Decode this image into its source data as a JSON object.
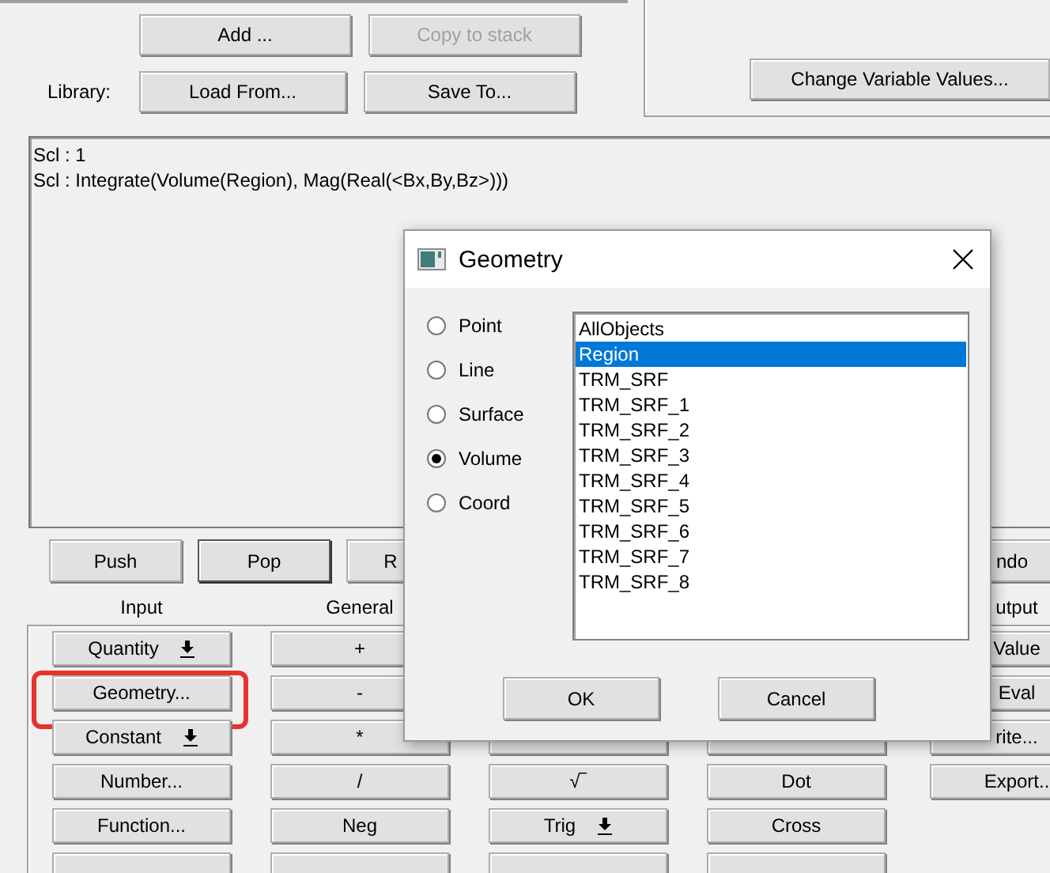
{
  "editor_buttons": [
    {
      "label": "Add ...",
      "disabled": false
    },
    {
      "label": "Copy to stack",
      "disabled": true
    }
  ],
  "library": {
    "label": "Library:",
    "buttons": [
      {
        "label": "Load From...",
        "disabled": false
      },
      {
        "label": "Save To...",
        "disabled": false
      }
    ]
  },
  "change_variables_button": "Change Variable Values...",
  "expression_lines": [
    "Scl : 1",
    "Scl : Integrate(Volume(Region), Mag(Real(<Bx,By,Bz>)))"
  ],
  "stack_buttons": [
    {
      "label": "Push",
      "default": false
    },
    {
      "label": "Pop",
      "default": true
    },
    {
      "label": "R",
      "default": false
    }
  ],
  "undo_button": "ndo",
  "palette": [
    {
      "header": "Input",
      "buttons": [
        {
          "label": "Quantity",
          "dropdown": true
        },
        {
          "label": "Geometry...",
          "highlighted": true
        },
        {
          "label": "Constant",
          "dropdown": true
        },
        {
          "label": "Number..."
        },
        {
          "label": "Function..."
        },
        {
          "kind": "covered"
        }
      ]
    },
    {
      "header": "General",
      "buttons": [
        {
          "label": "+"
        },
        {
          "label": "-"
        },
        {
          "label": "*"
        },
        {
          "label": "/"
        },
        {
          "label": "Neg"
        },
        {
          "kind": "covered"
        }
      ]
    },
    {
      "buttons": [
        {
          "kind": "covered"
        },
        {
          "label": "√‾"
        },
        {
          "label": "Trig",
          "dropdown": true
        },
        {
          "kind": "covered"
        }
      ]
    },
    {
      "buttons": [
        {
          "kind": "covered"
        },
        {
          "label": "Dot"
        },
        {
          "label": "Cross"
        },
        {
          "kind": "covered"
        }
      ]
    },
    {
      "header": "utput",
      "buttons": [
        {
          "label": "Value"
        },
        {
          "label": "Eval"
        },
        {
          "label": "rite..."
        },
        {
          "label": "Export.."
        }
      ]
    }
  ],
  "dialog": {
    "title": "Geometry",
    "options": [
      {
        "label": "Point",
        "selected": false
      },
      {
        "label": "Line",
        "selected": false
      },
      {
        "label": "Surface",
        "selected": false
      },
      {
        "label": "Volume",
        "selected": true
      },
      {
        "label": "Coord",
        "selected": false
      }
    ],
    "objects": [
      {
        "label": "AllObjects",
        "selected": false
      },
      {
        "label": "Region",
        "selected": true
      },
      {
        "label": "TRM_SRF",
        "selected": false
      },
      {
        "label": "TRM_SRF_1",
        "selected": false
      },
      {
        "label": "TRM_SRF_2",
        "selected": false
      },
      {
        "label": "TRM_SRF_3",
        "selected": false
      },
      {
        "label": "TRM_SRF_4",
        "selected": false
      },
      {
        "label": "TRM_SRF_5",
        "selected": false
      },
      {
        "label": "TRM_SRF_6",
        "selected": false
      },
      {
        "label": "TRM_SRF_7",
        "selected": false
      },
      {
        "label": "TRM_SRF_8",
        "selected": false
      }
    ],
    "buttons": [
      "OK",
      "Cancel"
    ]
  }
}
